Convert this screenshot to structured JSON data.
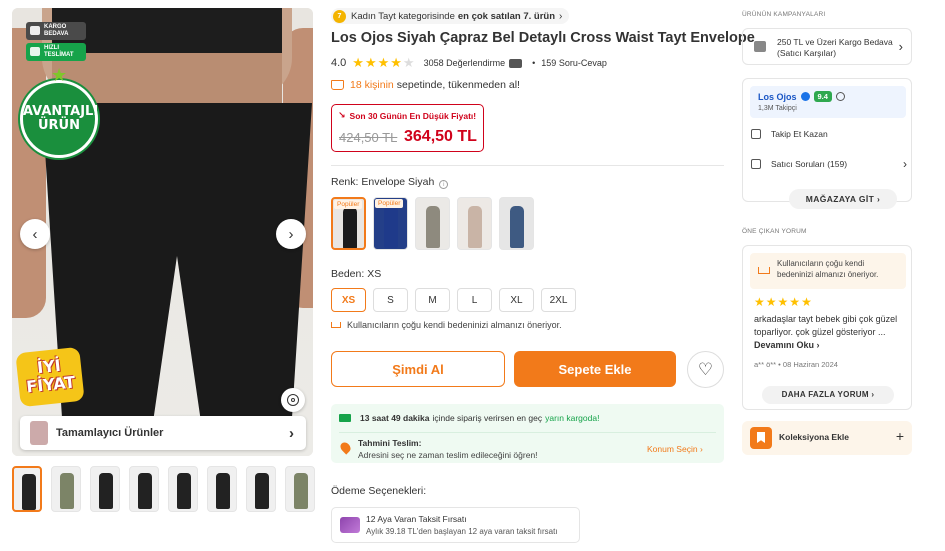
{
  "gallery": {
    "badge_kargo": "KARGO BEDAVA",
    "badge_hizli": "HIZLI TESLİMAT",
    "avantajli": "AVANTAJLI ÜRÜN",
    "iyi_fiyat": "İYİ FİYAT",
    "complementary": "Tamamlayıcı Ürünler",
    "thumbnail_count": 8,
    "active_thumbnail": 1
  },
  "product": {
    "bestseller_prefix": "Kadın Tayt kategorisinde",
    "bestseller_rank": "en çok satılan 7. ürün",
    "brand": "Los Ojos",
    "name": "Siyah Çapraz Bel Detaylı Cross Waist Tayt Envelope",
    "rating": "4.0",
    "rating_value": 4,
    "reviews": "3058 Değerlendirme",
    "qa": "159 Soru-Cevap",
    "basket_highlight": "18 kişinin",
    "basket_text": "sepetinde, tükenmeden al!",
    "lowest_price_label": "Son 30 Günün En Düşük Fiyatı!",
    "old_price": "424,50 TL",
    "new_price": "364,50 TL",
    "color_label": "Renk: Envelope Siyah",
    "swatches": [
      {
        "tag": "Popüler",
        "color": "#1c1c1c",
        "bg": "#e9e6e2"
      },
      {
        "tag": "Popüler",
        "color": "#1f3a8a",
        "bg": "#243f88"
      },
      {
        "tag": "",
        "color": "#8e8a7e",
        "bg": "#ebe9e6"
      },
      {
        "tag": "",
        "color": "#c9b4a6",
        "bg": "#ede9e5"
      },
      {
        "tag": "",
        "color": "#3e5a82",
        "bg": "#e6e6e6"
      }
    ],
    "size_label": "Beden: XS",
    "sizes": [
      "XS",
      "S",
      "M",
      "L",
      "XL",
      "2XL"
    ],
    "size_advice": "Kullanıcıların çoğu kendi bedeninizi almanızı öneriyor.",
    "buy_now": "Şimdi Al",
    "add_to_cart": "Sepete Ekle"
  },
  "shipping": {
    "time": "13 saat 49 dakika",
    "text": "içinde sipariş verirsen en geç",
    "green": "yarın kargoda!",
    "est_title": "Tahmini Teslim:",
    "est_sub": "Adresini seç ne zaman teslim edileceğini öğren!",
    "konum": "Konum Seçin"
  },
  "payment": {
    "title": "Ödeme Seçenekleri:",
    "taksit_title": "12 Aya Varan Taksit Fırsatı",
    "taksit_sub": "Aylık 39.18 TL'den başlayan 12 aya varan taksit fırsatı"
  },
  "sidebar": {
    "campaigns_title": "ÜRÜNÜN KAMPANYALARI",
    "campaign_line1": "250 TL ve Üzeri Kargo Bedava",
    "campaign_line2": "(Satıcı Karşılar)",
    "seller_name": "Los Ojos",
    "seller_score": "9.4",
    "followers": "1,3M Takipçi",
    "takip": "Takip Et Kazan",
    "seller_questions": "Satıcı Soruları (159)",
    "store": "MAĞAZAYA GİT",
    "review_title": "ÖNE ÇIKAN YORUM",
    "review_hint": "Kullanıcıların çoğu kendi bedeninizi almanızı öneriyor.",
    "review_stars": 5,
    "review_body": "arkadaşlar tayt bebek gibi çok güzel toparliyor. çok güzel gösteriyor ...",
    "review_more_link": "Devamını Oku",
    "review_meta": "a** ö** • 08 Haziran 2024",
    "more_reviews": "DAHA FAZLA YORUM",
    "collection": "Koleksiyona Ekle"
  }
}
